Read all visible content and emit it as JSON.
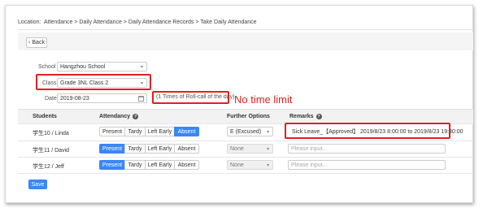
{
  "breadcrumb": {
    "prefix": "Location:",
    "path": "Attendance > Daily Attendance > Daily Attendance Records > Take Daily Attendance"
  },
  "back_button": {
    "label": "Back",
    "icon": "chevron-left-icon"
  },
  "form": {
    "school_label": "School",
    "school_value": "Hangzhou School",
    "class_label": "Class",
    "class_value": "Grade 3NL Class 2",
    "date_label": "Date",
    "date_value": "2019-08-23",
    "roll_call_note": "(1 Times of Roll-call of the day)"
  },
  "annotation": {
    "text": "No time limit",
    "color": "#e02020"
  },
  "table": {
    "headers": {
      "students": "Students",
      "attendancy": "Attendancy",
      "further_options": "Further Options",
      "remarks": "Remarks"
    },
    "attendance_options": [
      "Present",
      "Tardy",
      "Left Early",
      "Absent"
    ],
    "rows": [
      {
        "student": "学生10 / Linda",
        "selected": "Absent",
        "further_option": "E (Excused)",
        "further_enabled": true,
        "remark": "Sick Leave_【Approved】 2019/8/23 8:00:00 to 2019/8/23 19:30:00",
        "remark_placeholder": ""
      },
      {
        "student": "学生11 / David",
        "selected": "Present",
        "further_option": "None",
        "further_enabled": false,
        "remark": "",
        "remark_placeholder": "Please input..."
      },
      {
        "student": "学生12 / Jeff",
        "selected": "Present",
        "further_option": "None",
        "further_enabled": false,
        "remark": "",
        "remark_placeholder": "Please input..."
      }
    ]
  },
  "save_button": {
    "label": "Save"
  },
  "colors": {
    "accent": "#3a87f5",
    "highlight": "#e02020"
  }
}
